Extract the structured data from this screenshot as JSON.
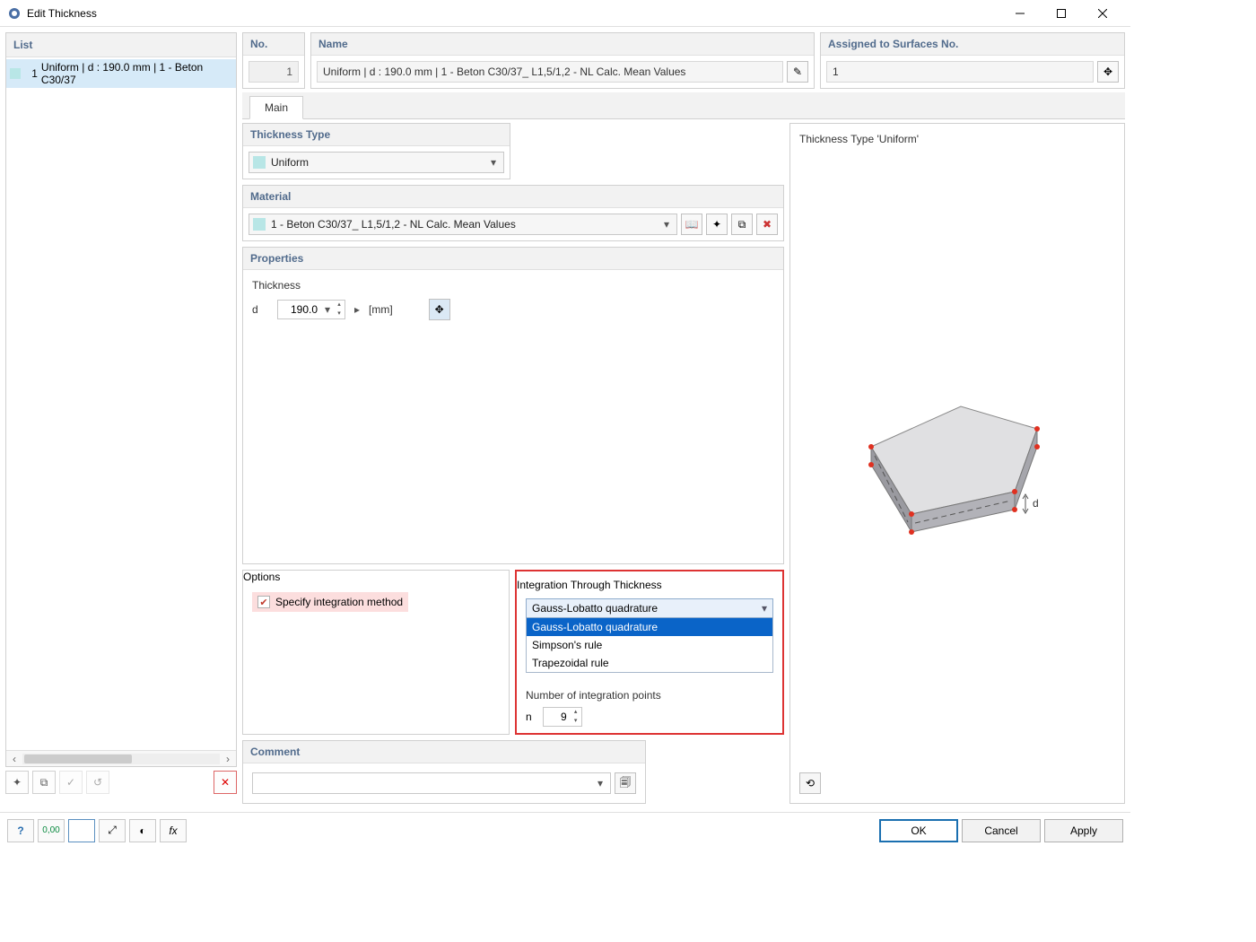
{
  "window": {
    "title": "Edit Thickness"
  },
  "left": {
    "header": "List",
    "item_no": "1",
    "item_text": "Uniform | d : 190.0 mm | 1 - Beton C30/37"
  },
  "top": {
    "no_header": "No.",
    "no_value": "1",
    "name_header": "Name",
    "name_value": "Uniform | d : 190.0 mm | 1 - Beton C30/37_ L1,5/1,2 - NL Calc. Mean Values",
    "assign_header": "Assigned to Surfaces No.",
    "assign_value": "1"
  },
  "tabs": {
    "main": "Main"
  },
  "type": {
    "header": "Thickness Type",
    "value": "Uniform"
  },
  "material": {
    "header": "Material",
    "value": "1 - Beton C30/37_ L1,5/1,2 - NL Calc. Mean Values"
  },
  "properties": {
    "header": "Properties",
    "thickness_label": "Thickness",
    "d_label": "d",
    "d_value": "190.0",
    "d_unit": "[mm]"
  },
  "options": {
    "header": "Options",
    "specify": "Specify integration method"
  },
  "integration": {
    "header": "Integration Through Thickness",
    "selected": "Gauss-Lobatto quadrature",
    "opt1": "Gauss-Lobatto quadrature",
    "opt2": "Simpson's rule",
    "opt3": "Trapezoidal rule",
    "num_label": "Number of integration points",
    "n_label": "n",
    "n_value": "9"
  },
  "comment": {
    "header": "Comment",
    "value": ""
  },
  "preview": {
    "label": "Thickness Type  'Uniform'",
    "d_sym": "d"
  },
  "footer": {
    "ok": "OK",
    "cancel": "Cancel",
    "apply": "Apply"
  }
}
